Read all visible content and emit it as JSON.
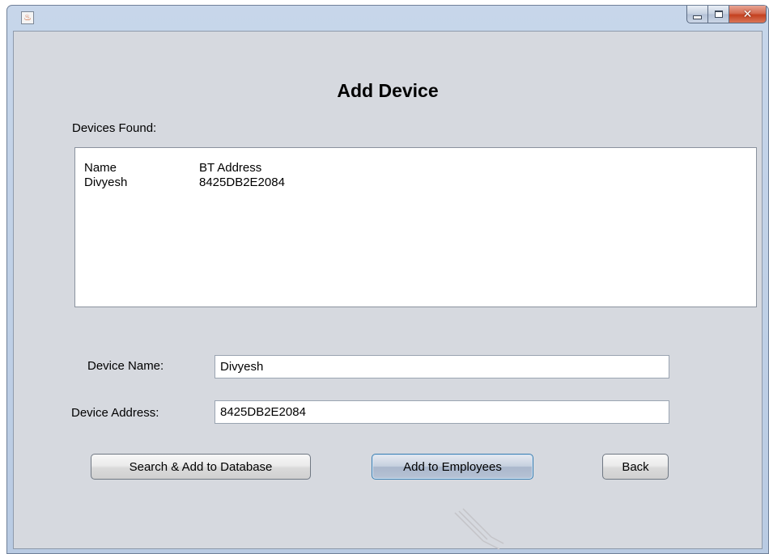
{
  "window": {
    "app_icon_glyph": "♨",
    "minimize_glyph": "",
    "maximize_glyph": "",
    "close_glyph": "✕"
  },
  "content": {
    "title": "Add Device",
    "devices_found_label": "Devices Found:",
    "device_list": {
      "columns": [
        "Name",
        "BT Address"
      ],
      "rows": [
        {
          "name": "Divyesh",
          "address": "8425DB2E2084"
        }
      ]
    },
    "device_name_label": "Device Name:",
    "device_name_value": "Divyesh",
    "device_address_label": "Device Address:",
    "device_address_value": "8425DB2E2084",
    "buttons": {
      "search_add": "Search & Add to Database",
      "add_employees": "Add to Employees",
      "back": "Back"
    }
  }
}
